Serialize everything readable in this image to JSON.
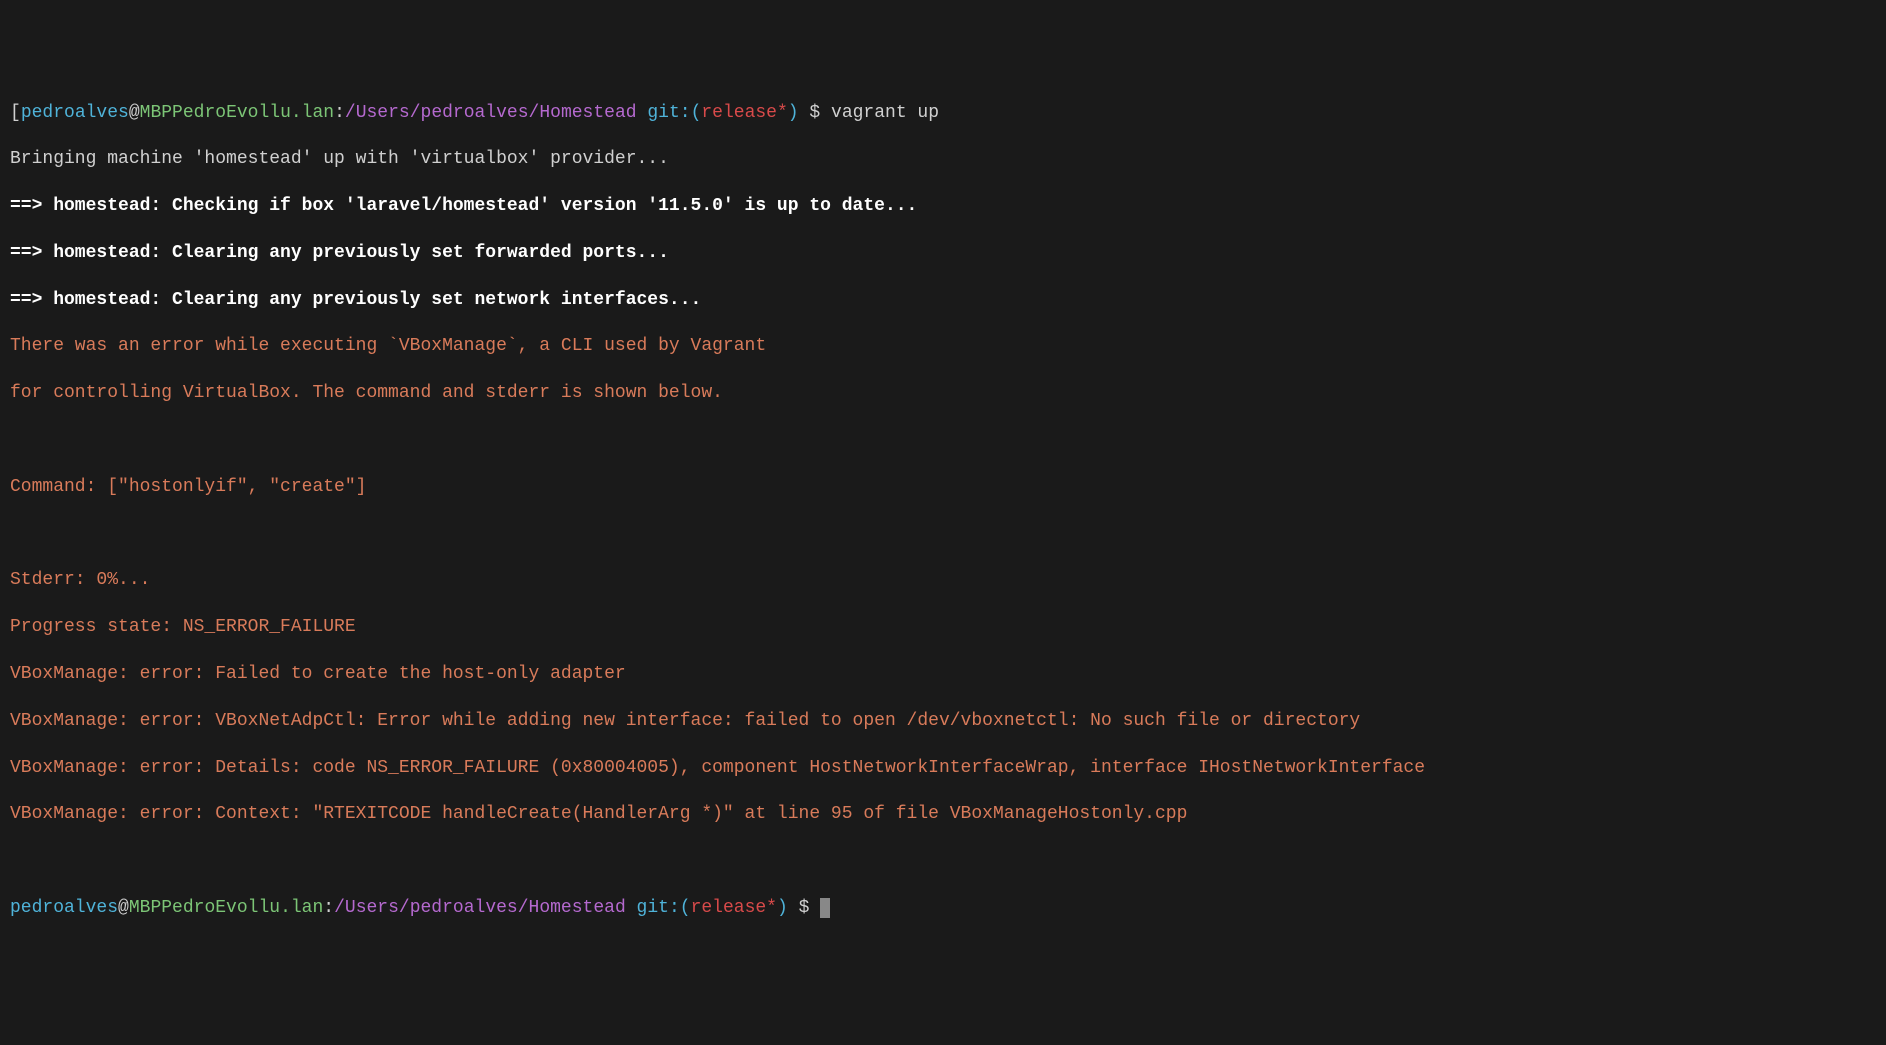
{
  "prompt1": {
    "lbracket": "[",
    "user": "pedroalves",
    "at": "@",
    "host": "MBPPedroEvollu.lan",
    "colon": ":",
    "path": "/Users/pedroalves/Homestead",
    "git_prefix": " git:(",
    "branch": "release*",
    "git_suffix": ")",
    "dollar": " $ ",
    "command": "vagrant up"
  },
  "output": {
    "l1": "Bringing machine 'homestead' up with 'virtualbox' provider...",
    "l2": "==> homestead: Checking if box 'laravel/homestead' version '11.5.0' is up to date...",
    "l3": "==> homestead: Clearing any previously set forwarded ports...",
    "l4": "==> homestead: Clearing any previously set network interfaces...",
    "e1": "There was an error while executing `VBoxManage`, a CLI used by Vagrant",
    "e2": "for controlling VirtualBox. The command and stderr is shown below.",
    "e3": "Command: [\"hostonlyif\", \"create\"]",
    "e4": "Stderr: 0%...",
    "e5": "Progress state: NS_ERROR_FAILURE",
    "e6": "VBoxManage: error: Failed to create the host-only adapter",
    "e7": "VBoxManage: error: VBoxNetAdpCtl: Error while adding new interface: failed to open /dev/vboxnetctl: No such file or directory",
    "e8": "VBoxManage: error: Details: code NS_ERROR_FAILURE (0x80004005), component HostNetworkInterfaceWrap, interface IHostNetworkInterface",
    "e9": "VBoxManage: error: Context: \"RTEXITCODE handleCreate(HandlerArg *)\" at line 95 of file VBoxManageHostonly.cpp"
  },
  "prompt2": {
    "user": "pedroalves",
    "at": "@",
    "host": "MBPPedroEvollu.lan",
    "colon": ":",
    "path": "/Users/pedroalves/Homestead",
    "git_prefix": " git:(",
    "branch": "release*",
    "git_suffix": ")",
    "dollar": " $ "
  }
}
